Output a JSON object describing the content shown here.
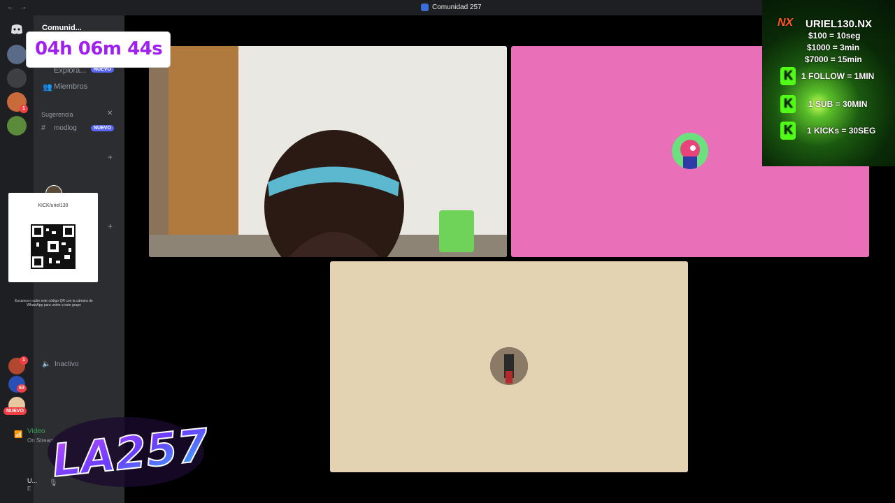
{
  "window": {
    "title": "Comunidad 257",
    "back": "←",
    "forward": "→"
  },
  "sidebar": {
    "server_name": "Comunid...",
    "items": [
      {
        "label": "Explora...",
        "badge": "NUEVO"
      },
      {
        "label": "Miembros"
      }
    ],
    "suggestion_header": "Sugerencia",
    "suggestion_item": {
      "label": "modlog",
      "badge": "NUEVO"
    },
    "inactive_label": "Inactivo",
    "voice": {
      "title": "Video",
      "subtitle": "On Stream"
    },
    "user": {
      "name": "U...",
      "status": "E"
    }
  },
  "server_rail": {
    "badges": [
      "1",
      "1",
      "63"
    ],
    "new_pill": "NUEVO"
  },
  "timer": {
    "value": "04h 06m 44s"
  },
  "qr_card": {
    "handle": "KICK/uriel130",
    "caption": "Escanea o sube este código QR con la cámara de WhatsApp para unirte a este grupo"
  },
  "promo": {
    "brand": "NX",
    "name": "URIEL130.NX",
    "rates": [
      "$100 = 10seg",
      "$1000 = 3min",
      "$7000 = 15min"
    ],
    "kick_rules": [
      "1 FOLLOW = 1MIN",
      "1 SUB = 30MIN",
      "1 KICKs = 30SEG"
    ],
    "kick_letter": "K"
  },
  "logo": {
    "text": "LA257"
  },
  "colors": {
    "tile_pink": "#e86fb8",
    "tile_beige": "#e4d3b3",
    "timer_purple": "#a020f0",
    "kick_green": "#53fc18",
    "discord_blurple": "#5865f2"
  }
}
